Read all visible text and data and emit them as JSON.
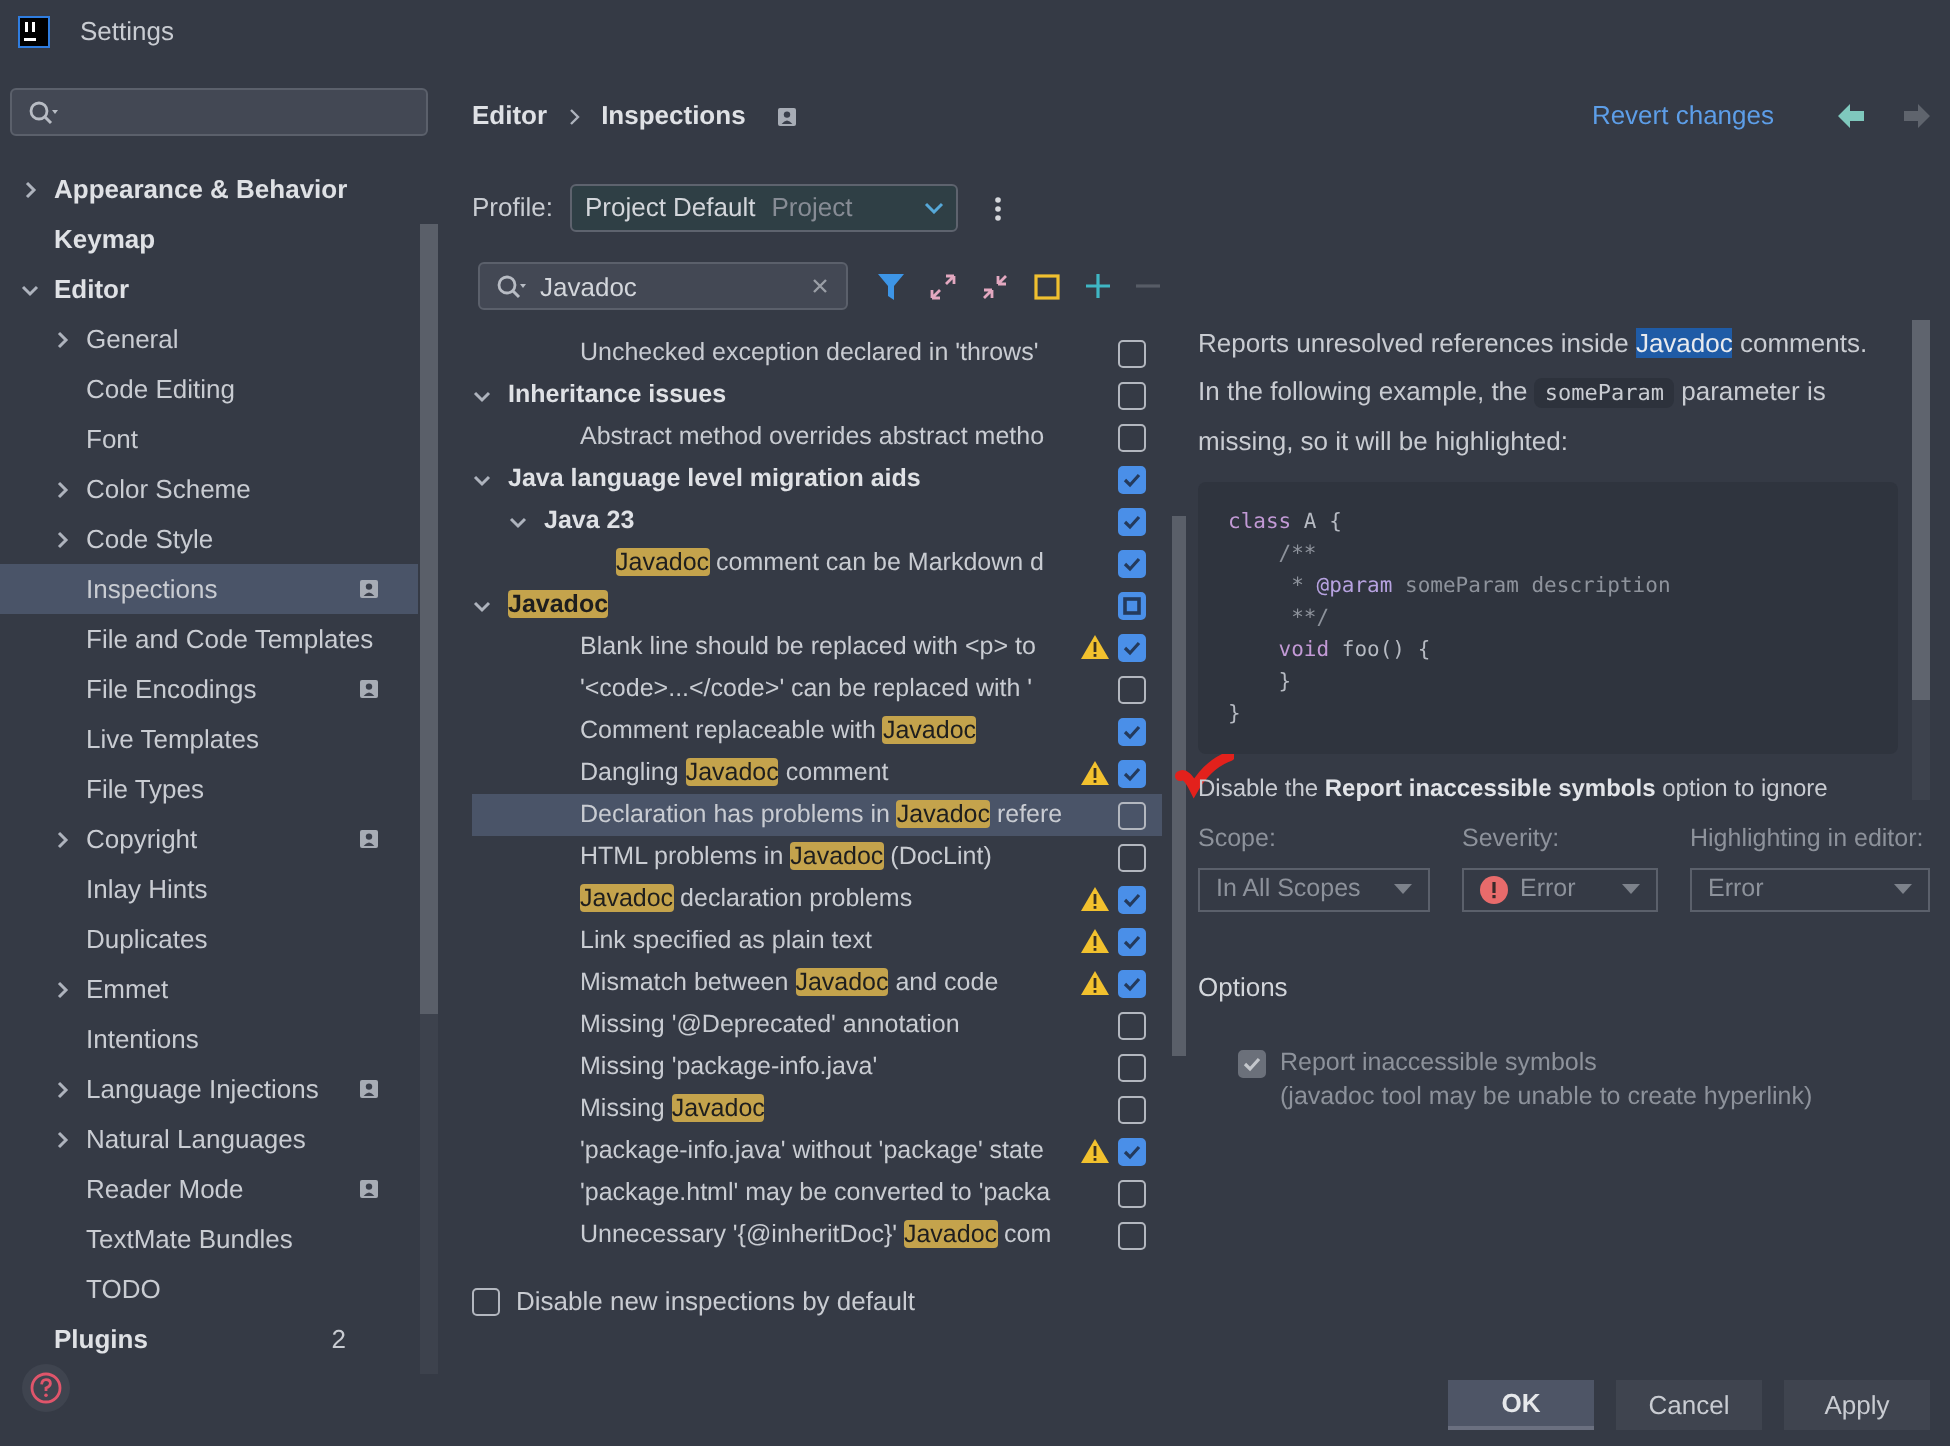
{
  "window": {
    "title": "Settings"
  },
  "sidebar": {
    "items": [
      {
        "label": "Appearance & Behavior",
        "expanded": false,
        "selected": false
      },
      {
        "label": "Keymap",
        "selected": false
      },
      {
        "label": "Editor",
        "expanded": true,
        "selected": false,
        "children": [
          {
            "label": "General",
            "expanded": false,
            "selected": false
          },
          {
            "label": "Code Editing",
            "selected": false
          },
          {
            "label": "Font",
            "selected": false
          },
          {
            "label": "Color Scheme",
            "expanded": false,
            "selected": false
          },
          {
            "label": "Code Style",
            "expanded": false,
            "selected": false
          },
          {
            "label": "Inspections",
            "selected": true,
            "project": true
          },
          {
            "label": "File and Code Templates",
            "selected": false
          },
          {
            "label": "File Encodings",
            "selected": false,
            "project": true
          },
          {
            "label": "Live Templates",
            "selected": false
          },
          {
            "label": "File Types",
            "selected": false
          },
          {
            "label": "Copyright",
            "expanded": false,
            "selected": false,
            "project": true
          },
          {
            "label": "Inlay Hints",
            "selected": false
          },
          {
            "label": "Duplicates",
            "selected": false
          },
          {
            "label": "Emmet",
            "expanded": false,
            "selected": false
          },
          {
            "label": "Intentions",
            "selected": false
          },
          {
            "label": "Language Injections",
            "expanded": false,
            "selected": false,
            "project": true
          },
          {
            "label": "Natural Languages",
            "expanded": false,
            "selected": false
          },
          {
            "label": "Reader Mode",
            "selected": false,
            "project": true
          },
          {
            "label": "TextMate Bundles",
            "selected": false
          },
          {
            "label": "TODO",
            "selected": false
          }
        ]
      },
      {
        "label": "Plugins",
        "selected": false,
        "count": "2"
      }
    ]
  },
  "breadcrumb": [
    "Editor",
    "Inspections"
  ],
  "revert_link": "Revert changes",
  "profile": {
    "label": "Profile:",
    "value": "Project Default",
    "scope": "Project"
  },
  "filter": {
    "value": "Javadoc"
  },
  "tree": [
    {
      "kind": "inspection",
      "parts": [
        {
          "text": "Unchecked exception declared in 'throws'",
          "highlight": false
        }
      ],
      "checked": false,
      "warning": false,
      "selected": false
    },
    {
      "kind": "group",
      "parts": [
        {
          "text": "Inheritance issues",
          "highlight": false
        }
      ],
      "expanded": true,
      "checked": false,
      "partial": false,
      "selected": false,
      "children": [
        {
          "kind": "inspection",
          "parts": [
            {
              "text": "Abstract method overrides abstract metho",
              "highlight": false
            }
          ],
          "checked": false,
          "warning": false,
          "selected": false
        }
      ]
    },
    {
      "kind": "group",
      "parts": [
        {
          "text": "Java language level migration aids",
          "highlight": false
        }
      ],
      "expanded": true,
      "checked": true,
      "partial": false,
      "selected": false,
      "children": [
        {
          "kind": "group",
          "parts": [
            {
              "text": "Java 23",
              "highlight": false
            }
          ],
          "expanded": true,
          "checked": true,
          "partial": false,
          "selected": false,
          "children": [
            {
              "kind": "inspection",
              "parts": [
                {
                  "text": "Javadoc",
                  "highlight": true
                },
                {
                  "text": " comment can be Markdown d",
                  "highlight": false
                }
              ],
              "checked": true,
              "warning": false,
              "selected": false
            }
          ]
        }
      ]
    },
    {
      "kind": "group",
      "parts": [
        {
          "text": "Javadoc",
          "highlight": true
        }
      ],
      "expanded": true,
      "checked": true,
      "partial": true,
      "selected": false,
      "children": [
        {
          "kind": "inspection",
          "parts": [
            {
              "text": "Blank line should be replaced with <p> to",
              "highlight": false
            }
          ],
          "checked": true,
          "warning": true,
          "selected": false
        },
        {
          "kind": "inspection",
          "parts": [
            {
              "text": "'<code>...</code>' can be replaced with '",
              "highlight": false
            }
          ],
          "checked": false,
          "warning": false,
          "selected": false
        },
        {
          "kind": "inspection",
          "parts": [
            {
              "text": "Comment replaceable with ",
              "highlight": false
            },
            {
              "text": "Javadoc",
              "highlight": true
            }
          ],
          "checked": true,
          "warning": false,
          "selected": false
        },
        {
          "kind": "inspection",
          "parts": [
            {
              "text": "Dangling ",
              "highlight": false
            },
            {
              "text": "Javadoc",
              "highlight": true
            },
            {
              "text": " comment",
              "highlight": false
            }
          ],
          "checked": true,
          "warning": true,
          "selected": false
        },
        {
          "kind": "inspection",
          "parts": [
            {
              "text": "Declaration has problems in ",
              "highlight": false
            },
            {
              "text": "Javadoc",
              "highlight": true
            },
            {
              "text": " refere",
              "highlight": false
            }
          ],
          "checked": false,
          "warning": false,
          "selected": true
        },
        {
          "kind": "inspection",
          "parts": [
            {
              "text": "HTML problems in ",
              "highlight": false
            },
            {
              "text": "Javadoc",
              "highlight": true
            },
            {
              "text": " (DocLint)",
              "highlight": false
            }
          ],
          "checked": false,
          "warning": false,
          "selected": false
        },
        {
          "kind": "inspection",
          "parts": [
            {
              "text": "Javadoc",
              "highlight": true
            },
            {
              "text": " declaration problems",
              "highlight": false
            }
          ],
          "checked": true,
          "warning": true,
          "selected": false
        },
        {
          "kind": "inspection",
          "parts": [
            {
              "text": "Link specified as plain text",
              "highlight": false
            }
          ],
          "checked": true,
          "warning": true,
          "selected": false
        },
        {
          "kind": "inspection",
          "parts": [
            {
              "text": "Mismatch between ",
              "highlight": false
            },
            {
              "text": "Javadoc",
              "highlight": true
            },
            {
              "text": " and code",
              "highlight": false
            }
          ],
          "checked": true,
          "warning": true,
          "selected": false
        },
        {
          "kind": "inspection",
          "parts": [
            {
              "text": "Missing '@Deprecated' annotation",
              "highlight": false
            }
          ],
          "checked": false,
          "warning": false,
          "selected": false
        },
        {
          "kind": "inspection",
          "parts": [
            {
              "text": "Missing 'package-info.java'",
              "highlight": false
            }
          ],
          "checked": false,
          "warning": false,
          "selected": false
        },
        {
          "kind": "inspection",
          "parts": [
            {
              "text": "Missing ",
              "highlight": false
            },
            {
              "text": "Javadoc",
              "highlight": true
            }
          ],
          "checked": false,
          "warning": false,
          "selected": false
        },
        {
          "kind": "inspection",
          "parts": [
            {
              "text": "'package-info.java' without 'package' state",
              "highlight": false
            }
          ],
          "checked": true,
          "warning": true,
          "selected": false
        },
        {
          "kind": "inspection",
          "parts": [
            {
              "text": "'package.html' may be converted to 'packa",
              "highlight": false
            }
          ],
          "checked": false,
          "warning": false,
          "selected": false
        },
        {
          "kind": "inspection",
          "parts": [
            {
              "text": "Unnecessary '{@inheritDoc}' ",
              "highlight": false
            },
            {
              "text": "Javadoc",
              "highlight": true
            },
            {
              "text": " com",
              "highlight": false
            }
          ],
          "checked": false,
          "warning": false,
          "selected": false
        }
      ]
    }
  ],
  "disable_new": {
    "label": "Disable new inspections by default",
    "checked": false
  },
  "description": {
    "paragraphs": [
      {
        "segments": [
          {
            "text": "Reports unresolved references inside ",
            "kind": "plain"
          },
          {
            "text": "Javadoc",
            "kind": "highlight"
          },
          {
            "text": " comments.",
            "kind": "plain"
          }
        ]
      },
      {
        "segments": [
          {
            "text": "In the following example, the ",
            "kind": "plain"
          },
          {
            "text": "someParam",
            "kind": "code"
          },
          {
            "text": " parameter is missing, so it will be highlighted:",
            "kind": "plain"
          }
        ]
      }
    ],
    "code": [
      [
        {
          "text": "class",
          "kind": "keyword"
        },
        {
          "text": " A {",
          "kind": "plain"
        }
      ],
      [
        {
          "text": "    /**",
          "kind": "comment"
        }
      ],
      [
        {
          "text": "     * ",
          "kind": "comment"
        },
        {
          "text": "@param",
          "kind": "tag"
        },
        {
          "text": " someParam description",
          "kind": "comment"
        }
      ],
      [
        {
          "text": "     **/",
          "kind": "comment"
        }
      ],
      [
        {
          "text": "    void",
          "kind": "keyword"
        },
        {
          "text": " foo() {",
          "kind": "plain"
        }
      ],
      [
        {
          "text": "    }",
          "kind": "plain"
        }
      ],
      [
        {
          "text": "}",
          "kind": "plain"
        }
      ]
    ],
    "after": [
      {
        "text": "Disable the ",
        "kind": "plain"
      },
      {
        "text": "Report inaccessible symbols",
        "kind": "bold"
      },
      {
        "text": " option to ignore",
        "kind": "plain"
      }
    ]
  },
  "settings": [
    {
      "label": "Scope:",
      "value": "In All Scopes",
      "kind": "plain"
    },
    {
      "label": "Severity:",
      "value": "Error",
      "kind": "error"
    },
    {
      "label": "Highlighting in editor:",
      "value": "Error",
      "kind": "plain"
    }
  ],
  "options": {
    "title": "Options",
    "items": [
      {
        "label": "Report inaccessible symbols",
        "note": "(javadoc tool may be unable to create hyperlink)",
        "checked": true,
        "disabled": true
      }
    ]
  },
  "buttons": [
    {
      "label": "OK",
      "default": true
    },
    {
      "label": "Cancel",
      "default": false
    },
    {
      "label": "Apply",
      "default": false
    }
  ]
}
